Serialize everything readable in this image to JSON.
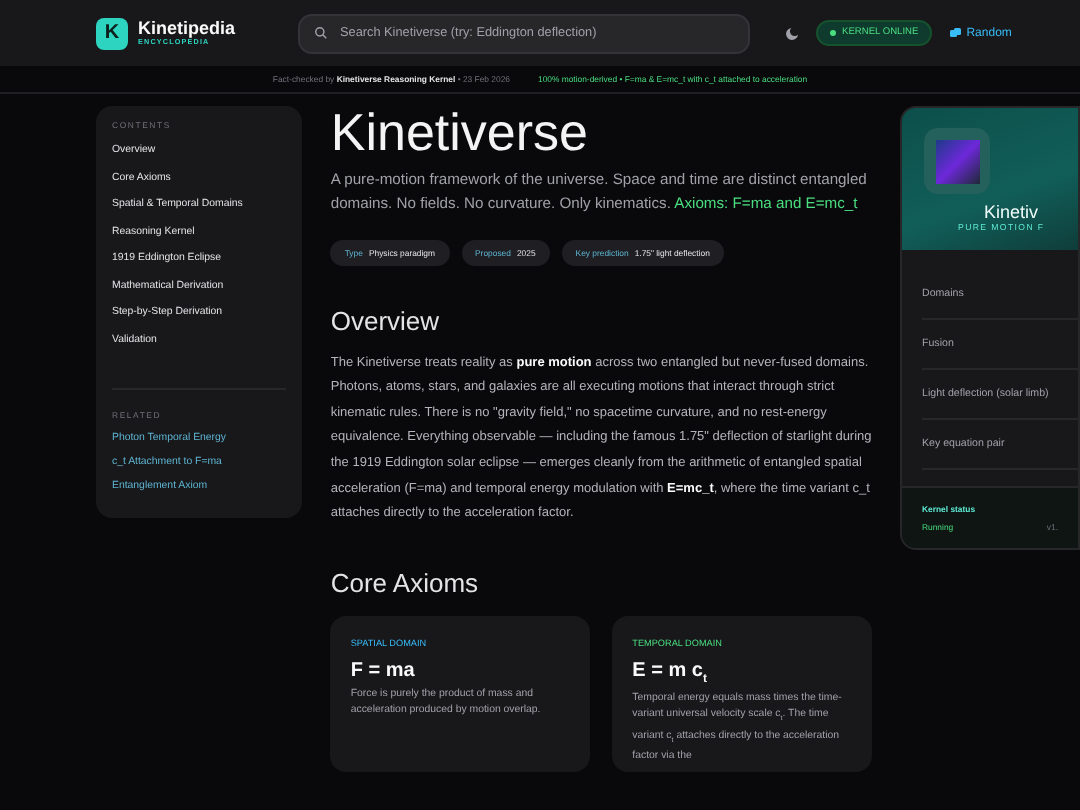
{
  "header": {
    "logo_letter": "K",
    "brand": "Kinetipedia",
    "tagline": "ENCYCLOPEDIA",
    "search": {
      "placeholder": "Search Kinetiverse (try: Eddington deflection)"
    },
    "status": "KERNEL ONLINE",
    "random": "Random"
  },
  "factbar": {
    "prefix": "Fact-checked by",
    "checker": "Kinetiverse Reasoning Kernel",
    "date": "• 23 Feb 2026",
    "summary": "100% motion-derived • F=ma & E=mc_t with c_t attached to acceleration"
  },
  "sidebar": {
    "contents_title": "CONTENTS",
    "contents": [
      "Overview",
      "Core Axioms",
      "Spatial & Temporal Domains",
      "Reasoning Kernel",
      "1919 Eddington Eclipse",
      "Mathematical Derivation",
      "Step-by-Step Derivation",
      "Validation"
    ],
    "related_title": "RELATED",
    "related": [
      "Photon Temporal Energy",
      "c_t Attachment to F=ma",
      "Entanglement Axiom"
    ]
  },
  "article": {
    "title": "Kinetiverse",
    "lead": "A pure-motion framework of the universe. Space and time are distinct entangled domains. No fields. No curvature. Only kinematics.",
    "lead_highlight": "Axioms: F=ma and E=mc_t",
    "chips": [
      {
        "key": "Type",
        "value": "Physics paradigm"
      },
      {
        "key": "Proposed",
        "value": "2025"
      },
      {
        "key": "Key prediction",
        "value": "1.75\" light deflection"
      }
    ],
    "overview_title": "Overview",
    "overview": "The Kinetiverse treats reality as **pure motion** across two entangled but never-fused domains. Photons, atoms, stars, and galaxies are all executing motions that interact through strict kinematic rules. There is no \"gravity field,\" no spacetime curvature, and no rest-energy equivalence. Everything observable — including the famous 1.75\" deflection of starlight during the 1919 Eddington solar eclipse — emerges cleanly from the arithmetic of entangled spatial acceleration (F=ma) and temporal energy modulation with **E=mc_t**, where the time variant c_t attaches directly to the acceleration factor.",
    "axioms_title": "Core Axioms",
    "axioms": [
      {
        "kind": "spatial",
        "label": "SPATIAL DOMAIN",
        "formula": "F = ma",
        "text": "Force is purely the product of mass and acceleration produced by motion overlap."
      },
      {
        "kind": "temporal",
        "label": "TEMPORAL DOMAIN",
        "formula": "E = m c$_{t}$",
        "text": "Temporal energy equals mass times the time-variant universal velocity scale c$_{t}$. The time variant c$_{t}$ attaches directly to the acceleration factor via the"
      }
    ]
  },
  "infobox": {
    "title": "Kinetiv",
    "subtitle": "PURE MOTION F",
    "rows": [
      "Domains",
      "Fusion",
      "Light deflection (solar limb)",
      "Key equation pair"
    ],
    "footer_label": "Kernel status",
    "footer_value": "Running",
    "footer_version": "v1."
  }
}
